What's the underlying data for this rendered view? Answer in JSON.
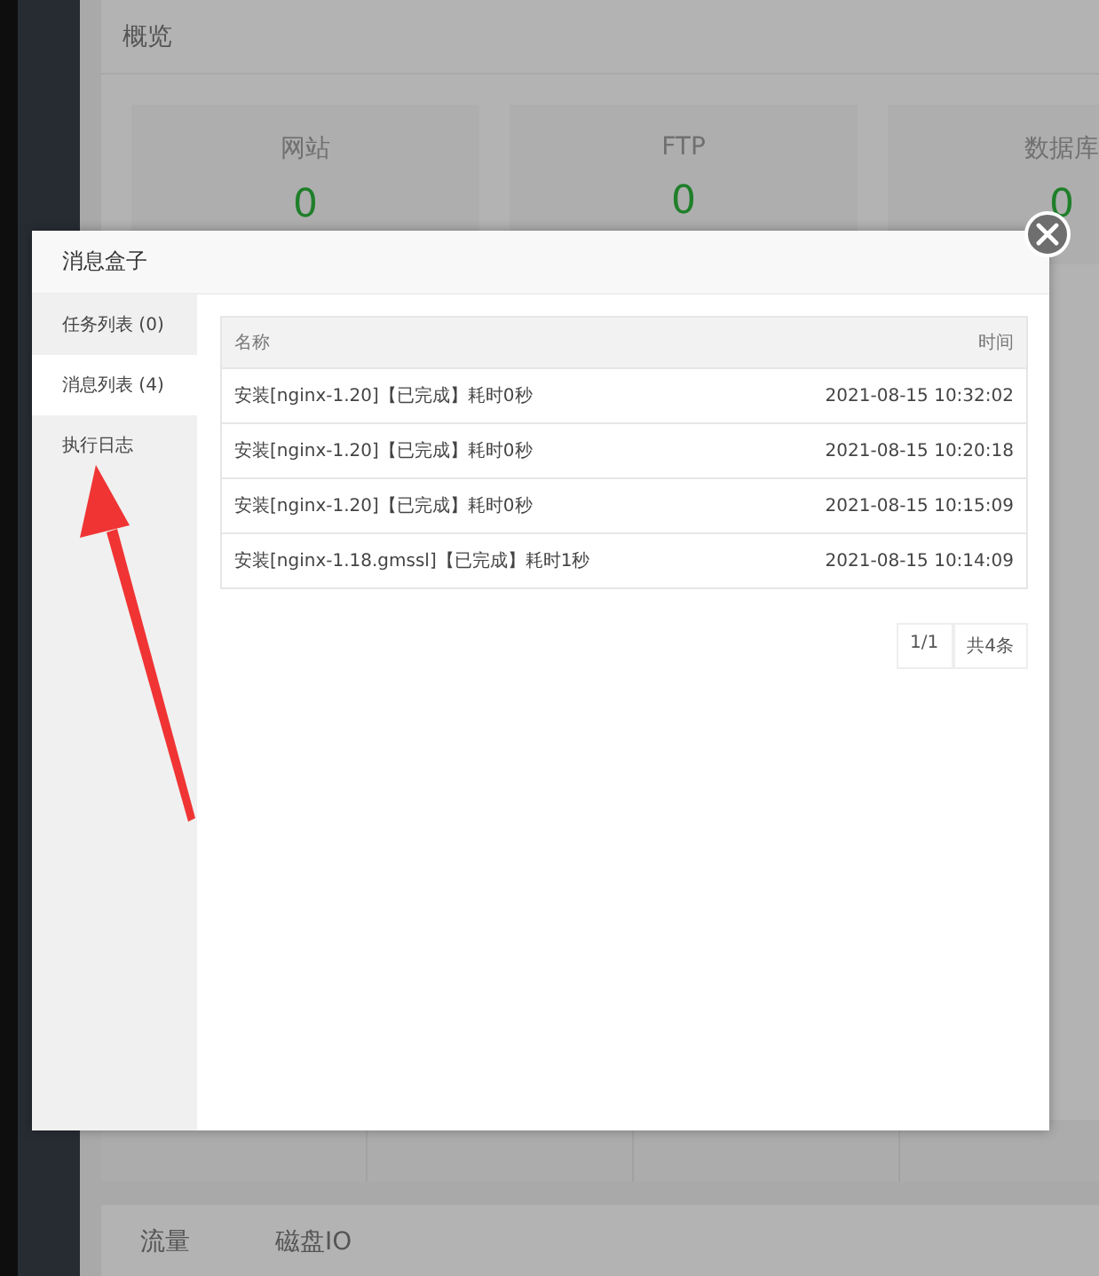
{
  "overview": {
    "title": "概览",
    "stats": [
      {
        "label": "网站",
        "value": "0"
      },
      {
        "label": "FTP",
        "value": "0"
      },
      {
        "label": "数据库",
        "value": "0"
      }
    ]
  },
  "bottom_tabs": [
    "流量",
    "磁盘IO"
  ],
  "dialog": {
    "title": "消息盒子",
    "tabs": [
      {
        "label": "任务列表 (0)",
        "selected": false
      },
      {
        "label": "消息列表 (4)",
        "selected": true
      },
      {
        "label": "执行日志",
        "selected": false
      }
    ],
    "table": {
      "columns": [
        "名称",
        "时间"
      ],
      "rows": [
        {
          "name": "安装[nginx-1.20]【已完成】耗时0秒",
          "time": "2021-08-15 10:32:02"
        },
        {
          "name": "安装[nginx-1.20]【已完成】耗时0秒",
          "time": "2021-08-15 10:20:18"
        },
        {
          "name": "安装[nginx-1.20]【已完成】耗时0秒",
          "time": "2021-08-15 10:15:09"
        },
        {
          "name": "安装[nginx-1.18.gmssl]【已完成】耗时1秒",
          "time": "2021-08-15 10:14:09"
        }
      ]
    },
    "pagination": {
      "page": "1/1",
      "total": "共4条"
    }
  }
}
